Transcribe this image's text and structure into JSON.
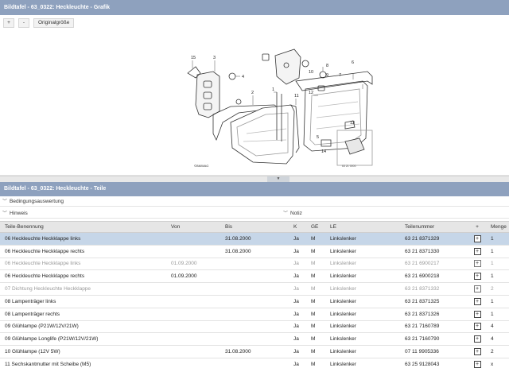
{
  "graphic_panel": {
    "title": "Bildtafel - 63_0322: Heckleuchte - Grafik",
    "buttons": {
      "zoom_in": "+",
      "zoom_out": "-",
      "original_size": "Originalgröße"
    },
    "diagram": {
      "callouts": [
        "15",
        "3",
        "4",
        "2",
        "1",
        "11",
        "12",
        "8",
        "9",
        "10",
        "6",
        "7",
        "5",
        "13",
        "14"
      ],
      "copyright": "©BMWAG",
      "image_id": "63 21 0000"
    }
  },
  "parts_panel": {
    "title": "Bildtafel - 63_0322: Heckleuchte - Teile",
    "bedingung_label": "Bedingungsauswertung",
    "hinweis_label": "Hinweis",
    "notiz_label": "Notiz",
    "columns": [
      "Teile-Benennung",
      "Von",
      "Bis",
      "K",
      "GE",
      "LE",
      "Teilenummer",
      "+",
      "Menge"
    ],
    "rows": [
      {
        "name": "06 Heckleuchte Heckklappe links",
        "von": "",
        "bis": "31.08.2000",
        "k": "Ja",
        "ge": "M",
        "le": "Linkslenker",
        "nr": "63 21 8371329",
        "menge": "1",
        "state": "selected"
      },
      {
        "name": "06 Heckleuchte Heckklappe rechts",
        "von": "",
        "bis": "31.08.2000",
        "k": "Ja",
        "ge": "M",
        "le": "Linkslenker",
        "nr": "63 21 8371330",
        "menge": "1",
        "state": "normal"
      },
      {
        "name": "06 Heckleuchte Heckklappe links",
        "von": "01.09.2000",
        "bis": "",
        "k": "Ja",
        "ge": "M",
        "le": "Linkslenker",
        "nr": "63 21 6900217",
        "menge": "1",
        "state": "grey"
      },
      {
        "name": "06 Heckleuchte Heckklappe rechts",
        "von": "01.09.2000",
        "bis": "",
        "k": "Ja",
        "ge": "M",
        "le": "Linkslenker",
        "nr": "63 21 6900218",
        "menge": "1",
        "state": "normal"
      },
      {
        "name": "07 Dichtung Heckleuchte Heckklappe",
        "von": "",
        "bis": "",
        "k": "Ja",
        "ge": "M",
        "le": "Linkslenker",
        "nr": "63 21 8371332",
        "menge": "2",
        "state": "grey"
      },
      {
        "name": "08 Lampenträger links",
        "von": "",
        "bis": "",
        "k": "Ja",
        "ge": "M",
        "le": "Linkslenker",
        "nr": "63 21 8371325",
        "menge": "1",
        "state": "normal"
      },
      {
        "name": "08 Lampenträger rechts",
        "von": "",
        "bis": "",
        "k": "Ja",
        "ge": "M",
        "le": "Linkslenker",
        "nr": "63 21 8371326",
        "menge": "1",
        "state": "normal"
      },
      {
        "name": "09 Glühlampe (P21W/12V/21W)",
        "von": "",
        "bis": "",
        "k": "Ja",
        "ge": "M",
        "le": "Linkslenker",
        "nr": "63 21 7160789",
        "menge": "4",
        "state": "normal"
      },
      {
        "name": "09 Glühlampe Longlife (P21W/12V/21W)",
        "von": "",
        "bis": "",
        "k": "Ja",
        "ge": "M",
        "le": "Linkslenker",
        "nr": "63 21 7160790",
        "menge": "4",
        "state": "normal"
      },
      {
        "name": "10 Glühlampe (12V 5W)",
        "von": "",
        "bis": "31.08.2000",
        "k": "Ja",
        "ge": "M",
        "le": "Linkslenker",
        "nr": "07 11 9905336",
        "menge": "2",
        "state": "normal"
      },
      {
        "name": "11 Sechskantmutter mit Scheibe (M5)",
        "von": "",
        "bis": "",
        "k": "Ja",
        "ge": "M",
        "le": "Linkslenker",
        "nr": "63 25 9128043",
        "menge": "x",
        "state": "normal"
      }
    ]
  },
  "colors": {
    "titlebar": "#8ea1be",
    "selected_row": "#c6d6e8",
    "header_bg": "#e6e6e6"
  }
}
